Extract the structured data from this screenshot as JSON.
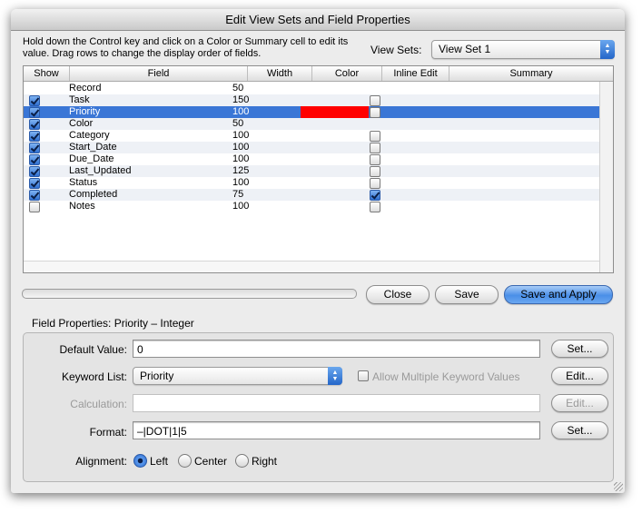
{
  "window": {
    "title": "Edit View Sets and Field Properties"
  },
  "instructions": "Hold down the Control key and click on a Color or Summary cell to edit its value. Drag rows to change the display order of fields.",
  "view_sets": {
    "label": "View Sets:",
    "selected": "View Set 1"
  },
  "table": {
    "columns": [
      "Show",
      "Field",
      "Width",
      "Color",
      "Inline Edit",
      "Summary"
    ],
    "rows": [
      {
        "show": null,
        "field": "Record",
        "width": "50",
        "color": "",
        "inline_edit": null,
        "summary": ""
      },
      {
        "show": true,
        "field": "Task",
        "width": "150",
        "color": "",
        "inline_edit": false,
        "summary": ""
      },
      {
        "show": true,
        "field": "Priority",
        "width": "100",
        "color": "#ff0000",
        "inline_edit": false,
        "summary": "",
        "selected": true
      },
      {
        "show": true,
        "field": "Color",
        "width": "50",
        "color": "",
        "inline_edit": null,
        "summary": ""
      },
      {
        "show": true,
        "field": "Category",
        "width": "100",
        "color": "",
        "inline_edit": false,
        "summary": ""
      },
      {
        "show": true,
        "field": "Start_Date",
        "width": "100",
        "color": "",
        "inline_edit": false,
        "summary": ""
      },
      {
        "show": true,
        "field": "Due_Date",
        "width": "100",
        "color": "",
        "inline_edit": false,
        "summary": ""
      },
      {
        "show": true,
        "field": "Last_Updated",
        "width": "125",
        "color": "",
        "inline_edit": false,
        "summary": ""
      },
      {
        "show": true,
        "field": "Status",
        "width": "100",
        "color": "",
        "inline_edit": false,
        "summary": ""
      },
      {
        "show": true,
        "field": "Completed",
        "width": "75",
        "color": "",
        "inline_edit": true,
        "summary": ""
      },
      {
        "show": false,
        "field": "Notes",
        "width": "100",
        "color": "",
        "inline_edit": false,
        "summary": ""
      }
    ]
  },
  "buttons": {
    "close": "Close",
    "save": "Save",
    "save_apply": "Save and Apply"
  },
  "field_properties": {
    "heading": "Field Properties: Priority – Integer",
    "default_value": {
      "label": "Default Value:",
      "value": "0",
      "button": "Set..."
    },
    "keyword_list": {
      "label": "Keyword List:",
      "selected": "Priority",
      "allow_multiple_label": "Allow Multiple Keyword Values",
      "allow_multiple_checked": false,
      "button": "Edit..."
    },
    "calculation": {
      "label": "Calculation:",
      "value": "",
      "button": "Edit..."
    },
    "format": {
      "label": "Format:",
      "value": "–|DOT|1|5",
      "button": "Set..."
    },
    "alignment": {
      "label": "Alignment:",
      "options": [
        "Left",
        "Center",
        "Right"
      ],
      "selected": "Left"
    }
  },
  "colors": {
    "selection": "#3a76d6",
    "accent": "#2f6fd0",
    "priority_color": "#ff0000"
  }
}
